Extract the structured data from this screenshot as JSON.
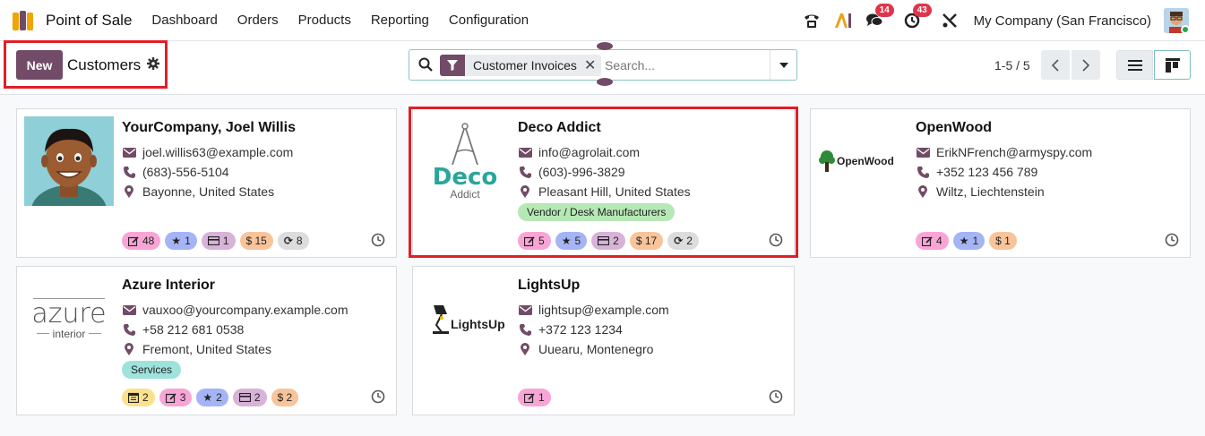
{
  "navbar": {
    "app_name": "Point of Sale",
    "menu": [
      "Dashboard",
      "Orders",
      "Products",
      "Reporting",
      "Configuration"
    ],
    "messages_count": "14",
    "activities_count": "43",
    "company": "My Company (San Francisco)"
  },
  "control": {
    "new_label": "New",
    "breadcrumb": "Customers",
    "facet_label": "Customer Invoices",
    "search_placeholder": "Search...",
    "pager": "1-5 / 5"
  },
  "cards": [
    {
      "name": "YourCompany, Joel Willis",
      "email": "joel.willis63@example.com",
      "phone": "(683)-556-5104",
      "location": "Bayonne, United States",
      "stats": [
        "48",
        "1",
        "1",
        "$ 15",
        "8"
      ]
    },
    {
      "name": "Deco Addict",
      "logo_main": "Deco",
      "logo_sub": "Addict",
      "email": "info@agrolait.com",
      "phone": "(603)-996-3829",
      "location": "Pleasant Hill, United States",
      "tag": "Vendor / Desk Manufacturers",
      "stats": [
        "5",
        "5",
        "2",
        "$ 17",
        "2"
      ]
    },
    {
      "name": "OpenWood",
      "logo_text": "OpenWood",
      "email": "ErikNFrench@armyspy.com",
      "phone": "+352 123 456 789",
      "location": "Wiltz, Liechtenstein",
      "stats": [
        "4",
        "1",
        "$ 1"
      ]
    },
    {
      "name": "Azure Interior",
      "logo_main": "azure",
      "logo_sub": "interior",
      "email": "vauxoo@yourcompany.example.com",
      "phone": "+58 212 681 0538",
      "location": "Fremont, United States",
      "tag": "Services",
      "stats": [
        "2",
        "3",
        "2",
        "2",
        "$ 2"
      ]
    },
    {
      "name": "LightsUp",
      "logo_text": "LightsUp",
      "email": "lightsup@example.com",
      "phone": "+372 123 1234",
      "location": "Uuearu, Montenegro",
      "stats": [
        "1"
      ]
    }
  ],
  "colors": {
    "brand": "#714b67",
    "highlight": "#e01f26",
    "stat_pink": "#f8a5d6",
    "stat_blue": "#a5b4f5",
    "stat_mauve": "#d8b3d8",
    "stat_orange": "#f9c49a",
    "stat_grey": "#dcdcdc",
    "stat_yellow": "#fbe18c",
    "tag_green": "#b5e8b5",
    "tag_teal": "#9de3dc"
  }
}
